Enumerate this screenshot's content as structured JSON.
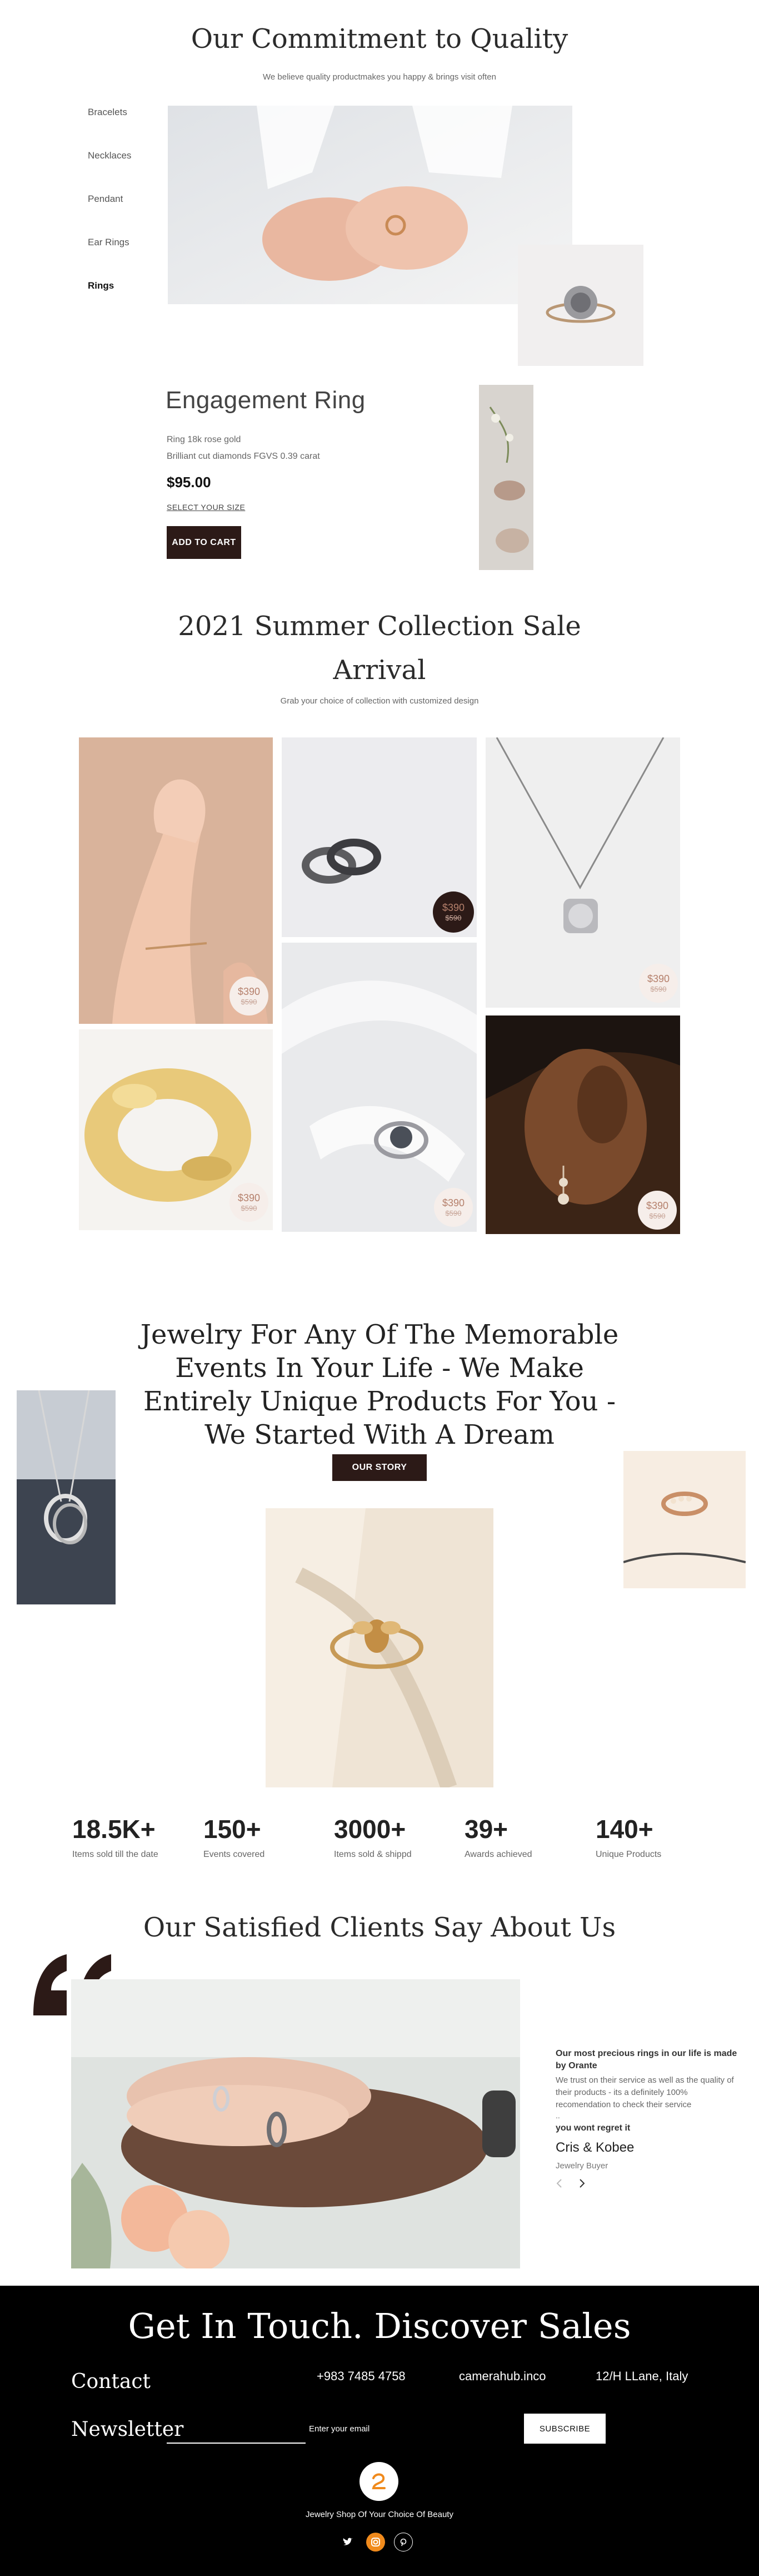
{
  "commitment": {
    "title": "Our Commitment to Quality",
    "subtitle": "We believe quality productmakes you happy & brings visit often",
    "categories": [
      "Bracelets",
      "Necklaces",
      "Pendant",
      "Ear Rings",
      "Rings"
    ],
    "active_category": "Rings"
  },
  "product": {
    "title": "Engagement Ring",
    "line1": "Ring 18k rose gold",
    "line2": "Brilliant cut diamonds FGVS 0.39 carat",
    "price": "$95.00",
    "size_link": "SELECT YOUR SIZE",
    "cart_button": "ADD TO CART"
  },
  "collection": {
    "title_line1": "2021 Summer Collection Sale",
    "title_line2": "Arrival",
    "subtitle": "Grab your choice of collection with customized design",
    "items": [
      {
        "now": "$390",
        "old": "$590"
      },
      {
        "now": "$390",
        "old": "$590"
      },
      {
        "now": "$390",
        "old": "$590"
      },
      {
        "now": "$390",
        "old": "$590"
      },
      {
        "now": "$390",
        "old": "$590"
      },
      {
        "now": "$390",
        "old": "$590"
      }
    ]
  },
  "story": {
    "line1": "Jewelry For Any Of The Memorable",
    "line2": "Events In Your Life - We Make",
    "line3": "Entirely Unique Products For You -",
    "line4": "We Started With A Dream",
    "button": "OUR STORY"
  },
  "stats": [
    {
      "num": "18.5K+",
      "label": "Items sold till the date"
    },
    {
      "num": "150+",
      "label": "Events covered"
    },
    {
      "num": "3000+",
      "label": "Items sold & shippd"
    },
    {
      "num": "39+",
      "label": "Awards achieved"
    },
    {
      "num": "140+",
      "label": "Unique Products"
    }
  ],
  "testimonial": {
    "title": "Our Satisfied Clients Say About Us",
    "heading": "Our most precious rings in our life is made by Orante",
    "body": "We trust on their service as well as the quality of their products - its a definitely 100% recomendation to check their service",
    "ellipsis": "..",
    "tagline": "you wont regret it",
    "name": "Cris & Kobee",
    "role": "Jewelry Buyer"
  },
  "footer": {
    "title": "Get In Touch. Discover Sales",
    "contact_label": "Contact",
    "phone": "+983 7485 4758",
    "email": "camerahub.inco",
    "address": "12/H LLane, Italy",
    "newsletter_label": "Newsletter",
    "email_placeholder": "Enter your email",
    "subscribe": "SUBSCRIBE",
    "tagline": "Jewelry Shop Of Your Choice Of Beauty"
  },
  "colors": {
    "accent_dark": "#2c1a17",
    "badge_text": "#b5806c",
    "footer_bg": "#000000",
    "social_active": "#f08a1c"
  },
  "icons": [
    "quote-icon",
    "chevron-left-icon",
    "chevron-right-icon",
    "brand-logo-icon",
    "twitter-icon",
    "instagram-icon",
    "pinterest-icon"
  ]
}
